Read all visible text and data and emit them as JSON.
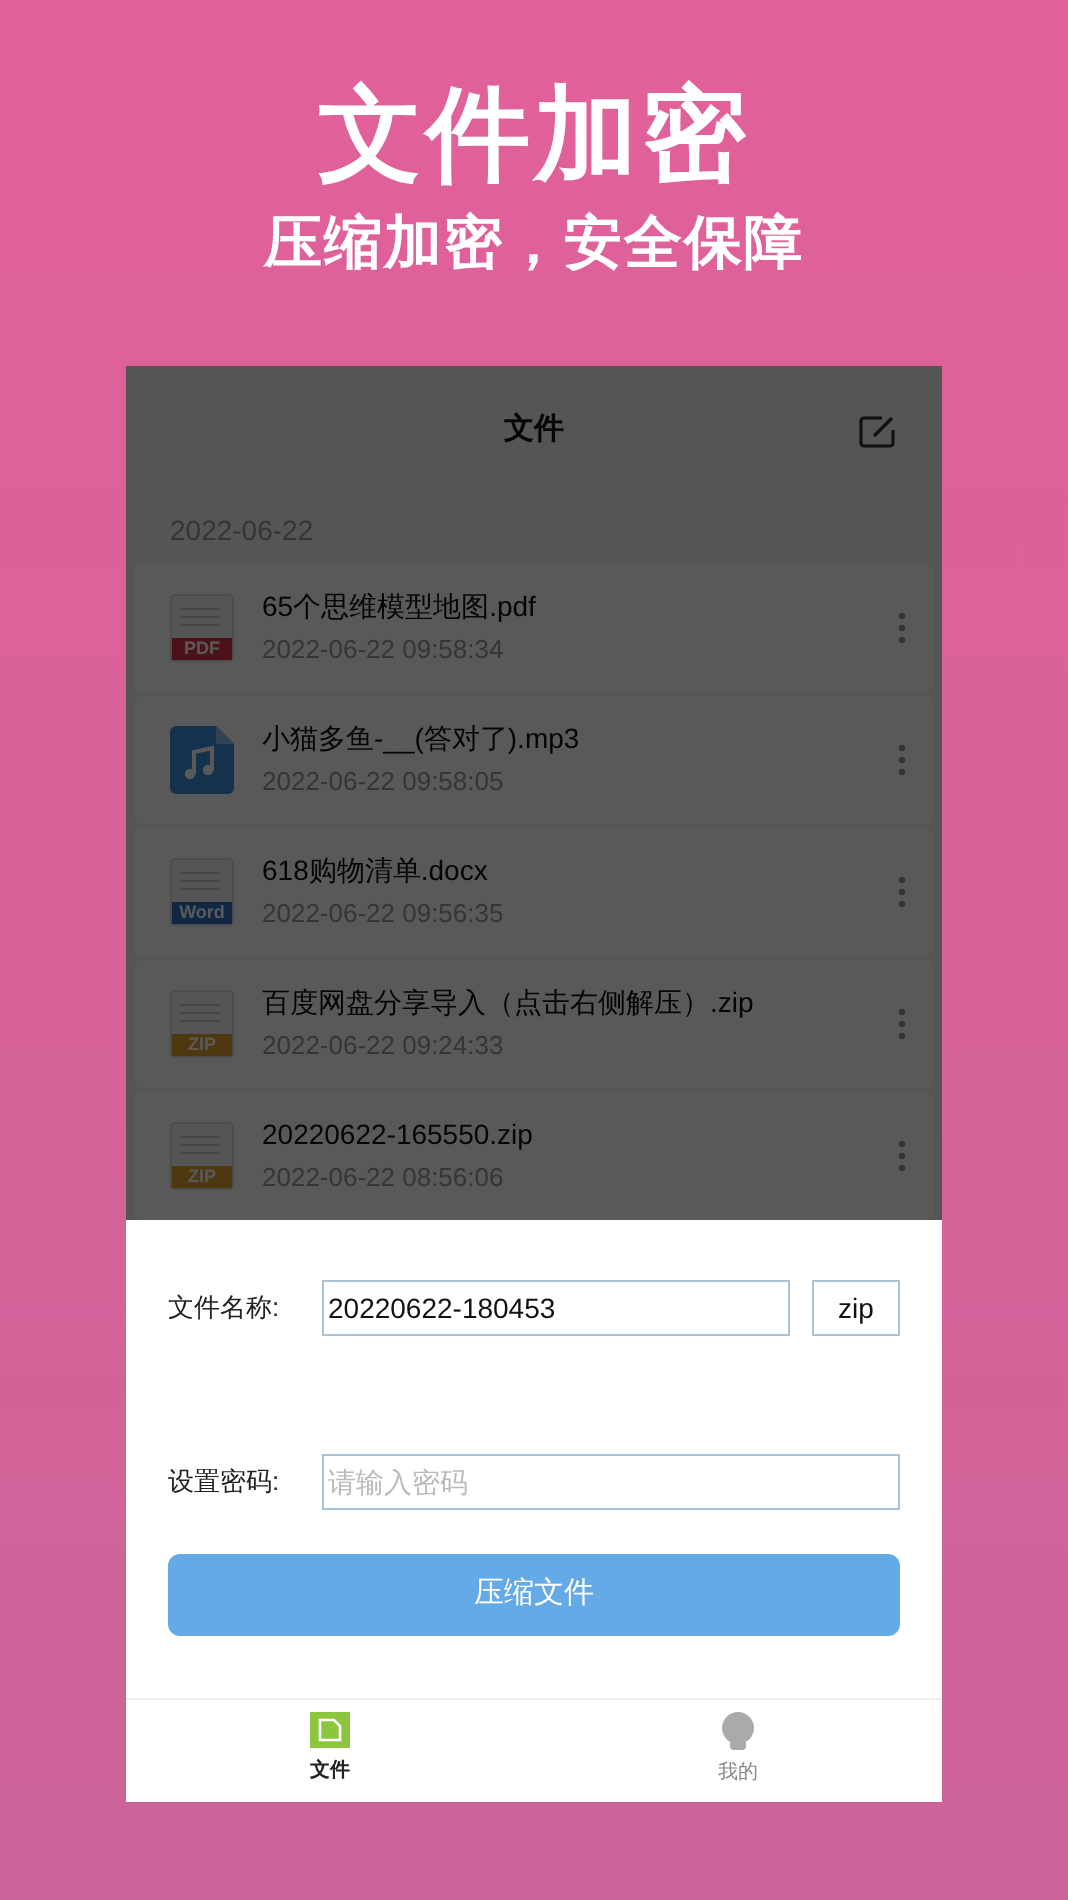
{
  "promo": {
    "title": "文件加密",
    "subtitle": "压缩加密，安全保障"
  },
  "app": {
    "title": "文件",
    "dimmed": true,
    "group": {
      "date": "2022-06-22",
      "files": [
        {
          "kind": "pdf",
          "badge": "PDF",
          "name": "65个思维模型地图.pdf",
          "time": "2022-06-22 09:58:34"
        },
        {
          "kind": "audio",
          "name": "小猫多鱼-__(答对了).mp3",
          "time": "2022-06-22 09:58:05"
        },
        {
          "kind": "word",
          "badge": "Word",
          "name": "618购物清单.docx",
          "time": "2022-06-22 09:56:35"
        },
        {
          "kind": "zip",
          "badge": "ZIP",
          "name": "百度网盘分享导入（点击右侧解压）.zip",
          "time": "2022-06-22 09:24:33"
        },
        {
          "kind": "zip",
          "badge": "ZIP",
          "name": "20220622-165550.zip",
          "time": "2022-06-22 08:56:06"
        }
      ]
    }
  },
  "sheet": {
    "name_label": "文件名称:",
    "name_value": "20220622-180453",
    "extension": "zip",
    "password_label": "设置密码:",
    "password_placeholder": "请输入密码",
    "submit": "压缩文件"
  },
  "tabs": [
    {
      "kind": "files",
      "label": "文件",
      "selected": true
    },
    {
      "kind": "mine",
      "label": "我的",
      "selected": false
    }
  ]
}
